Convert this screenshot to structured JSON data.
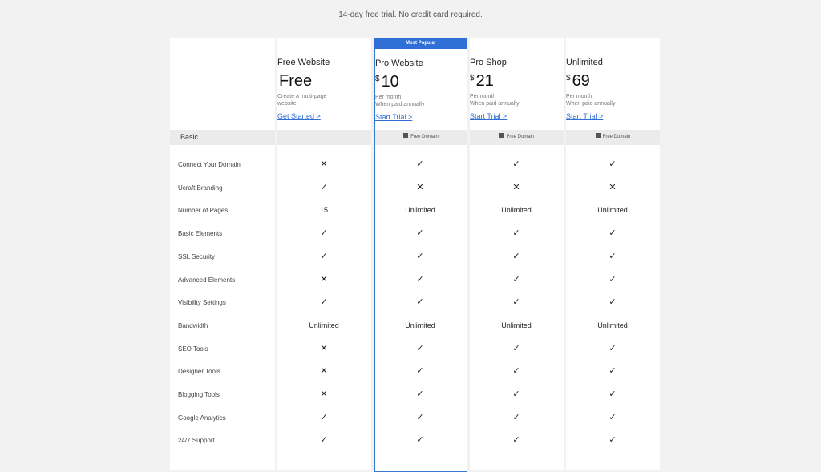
{
  "subtitle": "14-day free trial. No credit card required.",
  "badge": "Most Popular",
  "plans": [
    {
      "name": "Free Website",
      "currency": "",
      "price": "Free",
      "sub1": "Create a multi-page",
      "sub2": "website",
      "cta": "Get Started >",
      "band": ""
    },
    {
      "name": "Pro Website",
      "currency": "$",
      "price": "10",
      "sub1": "Per month",
      "sub2": "When paid annually",
      "cta": "Start Trial >",
      "band": "Free Domain"
    },
    {
      "name": "Pro Shop",
      "currency": "$",
      "price": "21",
      "sub1": "Per month",
      "sub2": "When paid annually",
      "cta": "Start Trial >",
      "band": "Free Domain"
    },
    {
      "name": "Unlimited",
      "currency": "$",
      "price": "69",
      "sub1": "Per month",
      "sub2": "When paid annually",
      "cta": "Start Trial >",
      "band": "Free Domain"
    }
  ],
  "section_label": "Basic",
  "symbols": {
    "yes": "✓",
    "no": "✕"
  },
  "features": [
    {
      "label": "Connect Your Domain",
      "values": [
        "no",
        "yes",
        "yes",
        "yes"
      ]
    },
    {
      "label": "Ucraft Branding",
      "values": [
        "yes",
        "no",
        "no",
        "no"
      ]
    },
    {
      "label": "Number of Pages",
      "values": [
        "15",
        "Unlimited",
        "Unlimited",
        "Unlimited"
      ]
    },
    {
      "label": "Basic Elements",
      "values": [
        "yes",
        "yes",
        "yes",
        "yes"
      ]
    },
    {
      "label": "SSL Security",
      "values": [
        "yes",
        "yes",
        "yes",
        "yes"
      ]
    },
    {
      "label": "Advanced Elements",
      "values": [
        "no",
        "yes",
        "yes",
        "yes"
      ]
    },
    {
      "label": "Visibility Settings",
      "values": [
        "yes",
        "yes",
        "yes",
        "yes"
      ]
    },
    {
      "label": "Bandwidth",
      "values": [
        "Unlimited",
        "Unlimited",
        "Unlimited",
        "Unlimited"
      ]
    },
    {
      "label": "SEO Tools",
      "values": [
        "no",
        "yes",
        "yes",
        "yes"
      ]
    },
    {
      "label": "Designer Tools",
      "values": [
        "no",
        "yes",
        "yes",
        "yes"
      ]
    },
    {
      "label": "Blogging Tools",
      "values": [
        "no",
        "yes",
        "yes",
        "yes"
      ]
    },
    {
      "label": "Google Analytics",
      "values": [
        "yes",
        "yes",
        "yes",
        "yes"
      ]
    },
    {
      "label": "24/7 Support",
      "values": [
        "yes",
        "yes",
        "yes",
        "yes"
      ]
    }
  ]
}
